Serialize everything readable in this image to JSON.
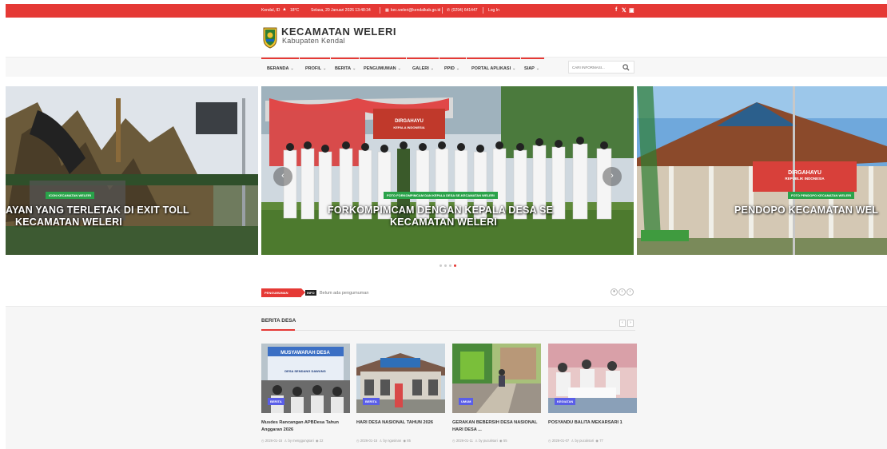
{
  "topbar": {
    "location": "Kendal, ID",
    "temperature": "18°C",
    "datetime": "Selasa, 20 Januari 2026 13:48:34",
    "email": "kec.weleri@kendalkab.go.id",
    "phone": "(0294) 641447",
    "login": "Log In",
    "social": [
      "f",
      "𝕏",
      "▣"
    ]
  },
  "header": {
    "title": "KECAMATAN WELERI",
    "subtitle": "Kabupaten Kendal"
  },
  "nav": {
    "items": [
      "BERANDA",
      "PROFIL",
      "BERITA",
      "PENGUMUMAN",
      "GALERI",
      "PPID",
      "PORTAL APLIKASI",
      "SIAP"
    ],
    "search_placeholder": "CARI INFORMASI..."
  },
  "slider": {
    "slides": [
      {
        "badge": "ICON KECAMATAN WELERI",
        "caption_line1": "AYAN YANG TERLETAK DI EXIT TOLL",
        "caption_line2": "KECAMATAN WELERI"
      },
      {
        "badge": "FOTO FORKOMPIMCAM DAN KEPALA DESA SE-KECAMATAN WELERI",
        "caption_line1": "FORKOMPIMCAM DENGAN KEPALA DESA SE",
        "caption_line2": "KECAMATAN WELERI",
        "banner": "DIRGAHAYU",
        "banner_sub": "KEPALA INDONESIA"
      },
      {
        "badge": "FOTO PENDOPO KECAMATAN WELERI",
        "caption_line1": "PENDOPO KECAMATAN WEL",
        "banner": "DIRGAHAYU",
        "banner_sub": "REPUBLIK INDONESIA"
      }
    ],
    "prev": "‹",
    "next": "›"
  },
  "ticker": {
    "label": "PENGUMUMAN",
    "tag": "INFO",
    "text": "Belum ada pengumuman"
  },
  "berita_desa": {
    "title": "BERITA DESA",
    "cards": [
      {
        "category": "BERITA",
        "title": "Musdes Rancangan APBDesa Tahun Anggaran 2026",
        "date": "2026-01-15",
        "author": "by menggungsari",
        "views": "22",
        "banner": "MUSYAWARAH DESA",
        "banner_sub": "DESA SENDANG DAWUNG"
      },
      {
        "category": "BERITA",
        "title": "HARI DESA NASIONAL TAHUN 2026",
        "date": "2026-01-15",
        "author": "by ngasinan",
        "views": "85"
      },
      {
        "category": "UMUM",
        "title": "GERAKAN BEBERSIH DESA NASIONAL HARI DESA ...",
        "date": "2026-01-11",
        "author": "by pucuksari",
        "views": "55"
      },
      {
        "category": "KEGIATAN",
        "title": "POSYANDU BALITA MEKARSARI 1",
        "date": "2026-01-07",
        "author": "by pucuksari",
        "views": "77"
      }
    ]
  },
  "colors": {
    "accent": "#e53935",
    "badge_green": "#2aa34a",
    "category": "#5a5ee8"
  }
}
